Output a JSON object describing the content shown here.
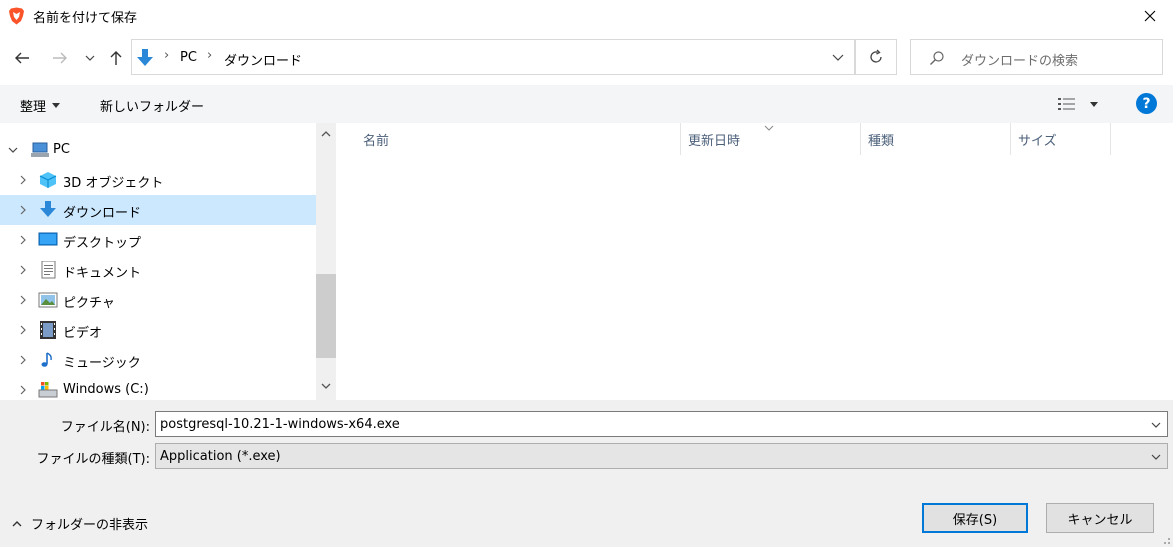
{
  "window": {
    "title": "名前を付けて保存"
  },
  "address": {
    "breadcrumb": [
      "PC",
      "ダウンロード"
    ],
    "search_placeholder": "ダウンロードの検索"
  },
  "toolbar": {
    "organize_label": "整理",
    "new_folder_label": "新しいフォルダー",
    "help_label": "?"
  },
  "nav": {
    "items": [
      {
        "label": "PC",
        "icon": "pc-icon"
      },
      {
        "label": "3D オブジェクト",
        "icon": "3d-objects-icon"
      },
      {
        "label": "ダウンロード",
        "icon": "download-icon",
        "selected": true
      },
      {
        "label": "デスクトップ",
        "icon": "desktop-icon"
      },
      {
        "label": "ドキュメント",
        "icon": "document-icon"
      },
      {
        "label": "ピクチャ",
        "icon": "picture-icon"
      },
      {
        "label": "ビデオ",
        "icon": "video-icon"
      },
      {
        "label": "ミュージック",
        "icon": "music-icon"
      },
      {
        "label": "Windows (C:)",
        "icon": "drive-icon"
      }
    ]
  },
  "columns": [
    "名前",
    "更新日時",
    "種類",
    "サイズ"
  ],
  "form": {
    "filename_label": "ファイル名(N):",
    "filename_value": "postgresql-10.21-1-windows-x64.exe",
    "filetype_label": "ファイルの種類(T):",
    "filetype_value": "Application (*.exe)"
  },
  "footer": {
    "hide_folders_label": "フォルダーの非表示",
    "save_label": "保存(S)",
    "cancel_label": "キャンセル"
  },
  "colors": {
    "accent": "#0078d7",
    "selection": "#cce8ff",
    "brave": "#fb542b"
  }
}
